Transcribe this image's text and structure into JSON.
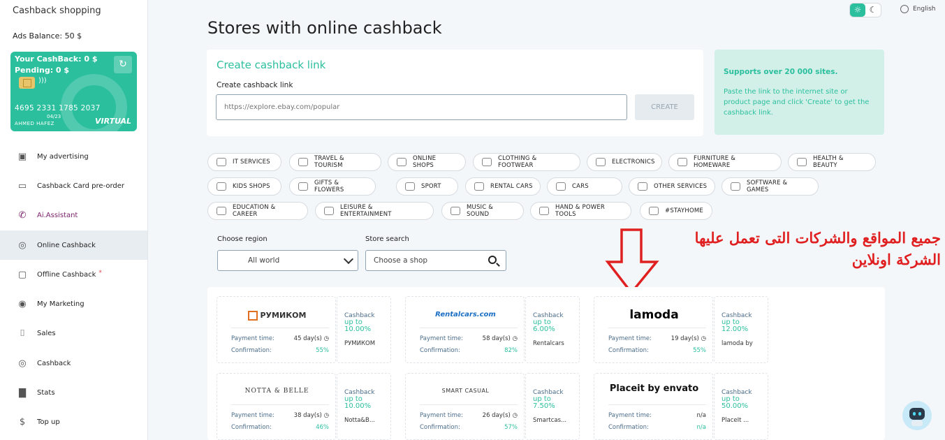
{
  "sidebar": {
    "title": "Cashback shopping",
    "ads_balance": "Ads Balance: 50 $",
    "card": {
      "your_cashback": "Your CashBack: 0 $",
      "pending": "Pending: 0 $",
      "number": "4695 2331 1785 2037",
      "expiry": "04/23",
      "holder": "AHMED HAFEZ",
      "type": "VIRTUAL"
    },
    "items": [
      {
        "label": "My advertising",
        "icon": "id-card-icon"
      },
      {
        "label": "Cashback Card pre-order",
        "icon": "credit-card-icon"
      },
      {
        "label": "Ai.Assistant",
        "icon": "phone-icon"
      },
      {
        "label": "Online Cashback",
        "icon": "percent-icon"
      },
      {
        "label": "Offline Cashback",
        "icon": "bag-icon",
        "badge": "*"
      },
      {
        "label": "My Marketing",
        "icon": "target-icon"
      },
      {
        "label": "Sales",
        "icon": "cart-icon"
      },
      {
        "label": "Cashback",
        "icon": "coin-icon"
      },
      {
        "label": "Stats",
        "icon": "bar-chart-icon"
      },
      {
        "label": "Top up",
        "icon": "dollar-icon"
      }
    ]
  },
  "header": {
    "language": "English"
  },
  "main": {
    "title": "Stores with online cashback",
    "create": {
      "heading": "Create cashback link",
      "label": "Create cashback link",
      "placeholder": "https://explore.ebay.com/popular",
      "button": "CREATE"
    },
    "support": {
      "title": "Supports over 20 000 sites.",
      "text": "Paste the link to the internet site or product page and click 'Create' to get the cashback link."
    },
    "categories": [
      "IT SERVICES",
      "TRAVEL & TOURISM",
      "ONLINE SHOPS",
      "CLOTHING & FOOTWEAR",
      "ELECTRONICS",
      "FURNITURE & HOMEWARE",
      "HEALTH & BEAUTY",
      "KIDS SHOPS",
      "GIFTS & FLOWERS",
      "SPORT",
      "RENTAL CARS",
      "CARS",
      "OTHER SERVICES",
      "SOFTWARE & GAMES",
      "EDUCATION & CAREER",
      "LEISURE & ENTERTAINMENT",
      "MUSIC & SOUND",
      "HAND & POWER TOOLS",
      "#STAYHOME"
    ],
    "filters": {
      "region_label": "Choose region",
      "region_value": "All world",
      "search_label": "Store search",
      "search_placeholder": "Choose a shop"
    },
    "annotation": "جميع المواقع والشركات التى تعمل عليها الشركة اونلاين",
    "stores": [
      {
        "logo": "РУМИКОМ",
        "payment_label": "Payment time:",
        "payment": "45 day(s)",
        "confirm_label": "Confirmation:",
        "confirm": "55%",
        "cashback": "Cashback",
        "upto": "up to",
        "percent": "10.00%",
        "name": "РУМИКОМ"
      },
      {
        "logo": "Rentalcars.com",
        "payment_label": "Payment time:",
        "payment": "58 day(s)",
        "confirm_label": "Confirmation:",
        "confirm": "82%",
        "cashback": "Cashback",
        "upto": "up to",
        "percent": "6.00%",
        "name": "Rentalcars"
      },
      {
        "logo": "lamoda",
        "payment_label": "Payment time:",
        "payment": "19 day(s)",
        "confirm_label": "Confirmation:",
        "confirm": "55%",
        "cashback": "Cashback",
        "upto": "up to",
        "percent": "12.00%",
        "name": "lamoda by"
      },
      {
        "logo": "NOTTA & BELLE",
        "payment_label": "Payment time:",
        "payment": "38 day(s)",
        "confirm_label": "Confirmation:",
        "confirm": "46%",
        "cashback": "Cashback",
        "upto": "up to",
        "percent": "10.00%",
        "name": "Notta&B..."
      },
      {
        "logo": "SMART CASUAL",
        "payment_label": "Payment time:",
        "payment": "26 day(s)",
        "confirm_label": "Confirmation:",
        "confirm": "57%",
        "cashback": "Cashback",
        "upto": "up to",
        "percent": "7.50%",
        "name": "Smartcas..."
      },
      {
        "logo": "Placeit by envato",
        "payment_label": "Payment time:",
        "payment": "n/a",
        "confirm_label": "Confirmation:",
        "confirm": "n/a",
        "cashback": "Cashback",
        "upto": "up to",
        "percent": "50.00%",
        "name": "PlaceIt ..."
      }
    ]
  },
  "colors": {
    "accent": "#2bbf9e",
    "annotation": "#e02020"
  }
}
